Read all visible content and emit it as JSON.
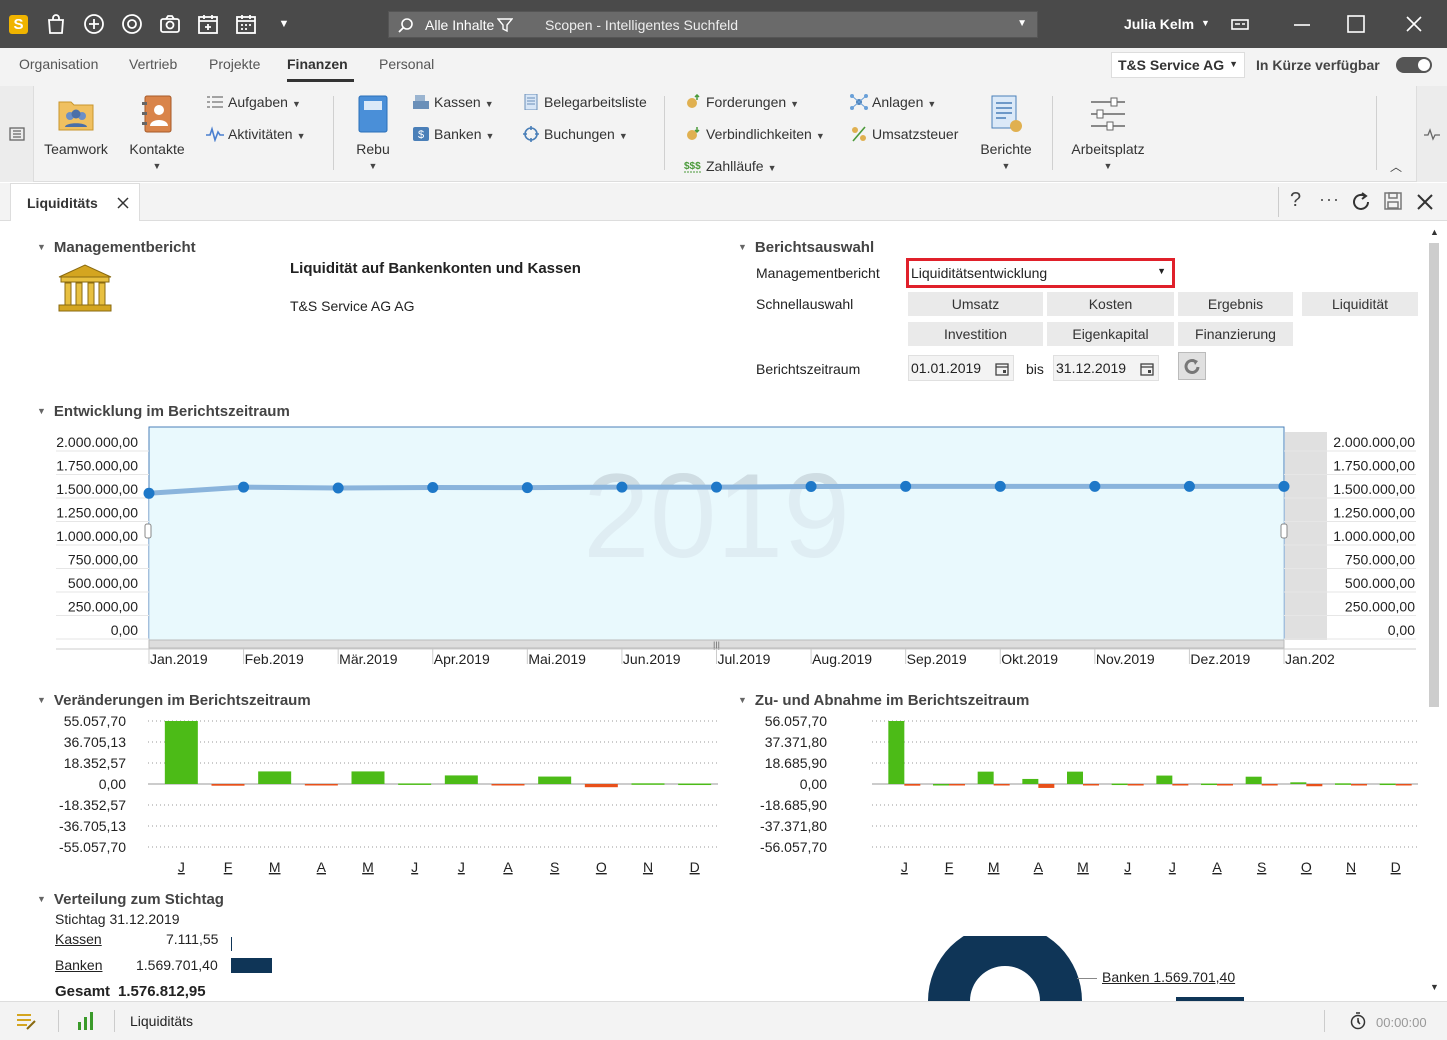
{
  "titlebar": {
    "search_scope": "Alle Inhalte",
    "search_placeholder": "Scopen - Intelligentes Suchfeld",
    "user_name": "Julia Kelm"
  },
  "menu": {
    "tabs": [
      "Organisation",
      "Vertrieb",
      "Projekte",
      "Finanzen",
      "Personal"
    ],
    "active": "Finanzen",
    "company": "T&S Service AG",
    "soon_label": "In Kürze verfügbar"
  },
  "ribbon": {
    "teamwork": "Teamwork",
    "kontakte": "Kontakte",
    "aufgaben": "Aufgaben",
    "aktivitaeten": "Aktivitäten",
    "rebu": "Rebu",
    "kassen": "Kassen",
    "banken": "Banken",
    "belegarbeitsliste": "Belegarbeitsliste",
    "buchungen": "Buchungen",
    "forderungen": "Forderungen",
    "verbindlichkeiten": "Verbindlichkeiten",
    "zahllaeufe": "Zahlläufe",
    "anlagen": "Anlagen",
    "umsatzsteuer": "Umsatzsteuer",
    "berichte": "Berichte",
    "arbeitsplatz": "Arbeitsplatz"
  },
  "doc_tab": {
    "label": "Liquiditäts"
  },
  "management": {
    "section": "Managementbericht",
    "report_title": "Liquidität auf Bankenkonten und Kassen",
    "company": "T&S Service AG AG"
  },
  "berichtsauswahl": {
    "section": "Berichtsauswahl",
    "management_label": "Managementbericht",
    "management_value": "Liquiditätsentwicklung",
    "quick_label": "Schnellauswahl",
    "quick_buttons": [
      "Umsatz",
      "Kosten",
      "Ergebnis",
      "Liquidität",
      "Investition",
      "Eigenkapital",
      "Finanzierung"
    ],
    "period_label": "Berichtszeitraum",
    "from": "01.01.2019",
    "bis": "bis",
    "to": "31.12.2019"
  },
  "sections": {
    "entwicklung": "Entwicklung im Berichtszeitraum",
    "veraenderungen": "Veränderungen im Berichtszeitraum",
    "zuabnahme": "Zu- und Abnahme im Berichtszeitraum",
    "verteilung": "Verteilung zum Stichtag"
  },
  "verteilung": {
    "stichtag": "Stichtag 31.12.2019",
    "kassen_label": "Kassen",
    "kassen_value": "7.111,55",
    "banken_label": "Banken",
    "banken_value": "1.569.701,40",
    "gesamt_label": "Gesamt",
    "gesamt_value": "1.576.812,95",
    "donut_label": "Banken 1.569.701,40"
  },
  "status": {
    "tab": "Liquiditäts",
    "timer": "00:00:00"
  },
  "colors": {
    "accent_red": "#e0202a",
    "line": "#1e78c8",
    "bar_pos": "#4cbb17",
    "bar_neg": "#e8501a",
    "donut": "#0f3557"
  },
  "chart_data": [
    {
      "type": "area",
      "watermark": "2019",
      "x": [
        "Jan.2019",
        "Feb.2019",
        "Mär.2019",
        "Apr.2019",
        "Mai.2019",
        "Jun.2019",
        "Jul.2019",
        "Aug.2019",
        "Sep.2019",
        "Okt.2019",
        "Nov.2019",
        "Dez.2019",
        "Jan.202"
      ],
      "values": [
        1550000,
        1616000,
        1606000,
        1612000,
        1610000,
        1616000,
        1616000,
        1622000,
        1624000,
        1624000,
        1624000,
        1624000,
        1624000
      ],
      "yticks": [
        "0,00",
        "250.000,00",
        "500.000,00",
        "750.000,00",
        "1.000.000,00",
        "1.250.000,00",
        "1.500.000,00",
        "1.750.000,00",
        "2.000.000,00"
      ],
      "ylim": [
        0,
        2000000
      ]
    },
    {
      "type": "bar",
      "categories": [
        "J",
        "F",
        "M",
        "A",
        "M",
        "J",
        "J",
        "A",
        "S",
        "O",
        "N",
        "D"
      ],
      "values": [
        55057.7,
        -1500,
        11000,
        -800,
        11000,
        500,
        7500,
        -1200,
        6500,
        -2800,
        600,
        400
      ],
      "yticks": [
        "-55.057,70",
        "-36.705,13",
        "-18.352,57",
        "0,00",
        "18.352,57",
        "36.705,13",
        "55.057,70"
      ],
      "ylim": [
        -55057.7,
        55057.7
      ]
    },
    {
      "type": "bar",
      "categories": [
        "J",
        "F",
        "M",
        "A",
        "M",
        "J",
        "J",
        "A",
        "S",
        "O",
        "N",
        "D"
      ],
      "series": [
        {
          "values": [
            56057.7,
            0,
            11000,
            4500,
            11000,
            400,
            7500,
            400,
            6500,
            1500,
            600,
            400
          ]
        },
        {
          "values": [
            -1500,
            -900,
            -800,
            -3500,
            -400,
            -300,
            -500,
            -1200,
            -600,
            -2000,
            -300,
            -300
          ]
        }
      ],
      "yticks": [
        "-56.057,70",
        "-37.371,80",
        "-18.685,90",
        "0,00",
        "18.685,90",
        "37.371,80",
        "56.057,70"
      ],
      "ylim": [
        -56057.7,
        56057.7
      ]
    }
  ]
}
